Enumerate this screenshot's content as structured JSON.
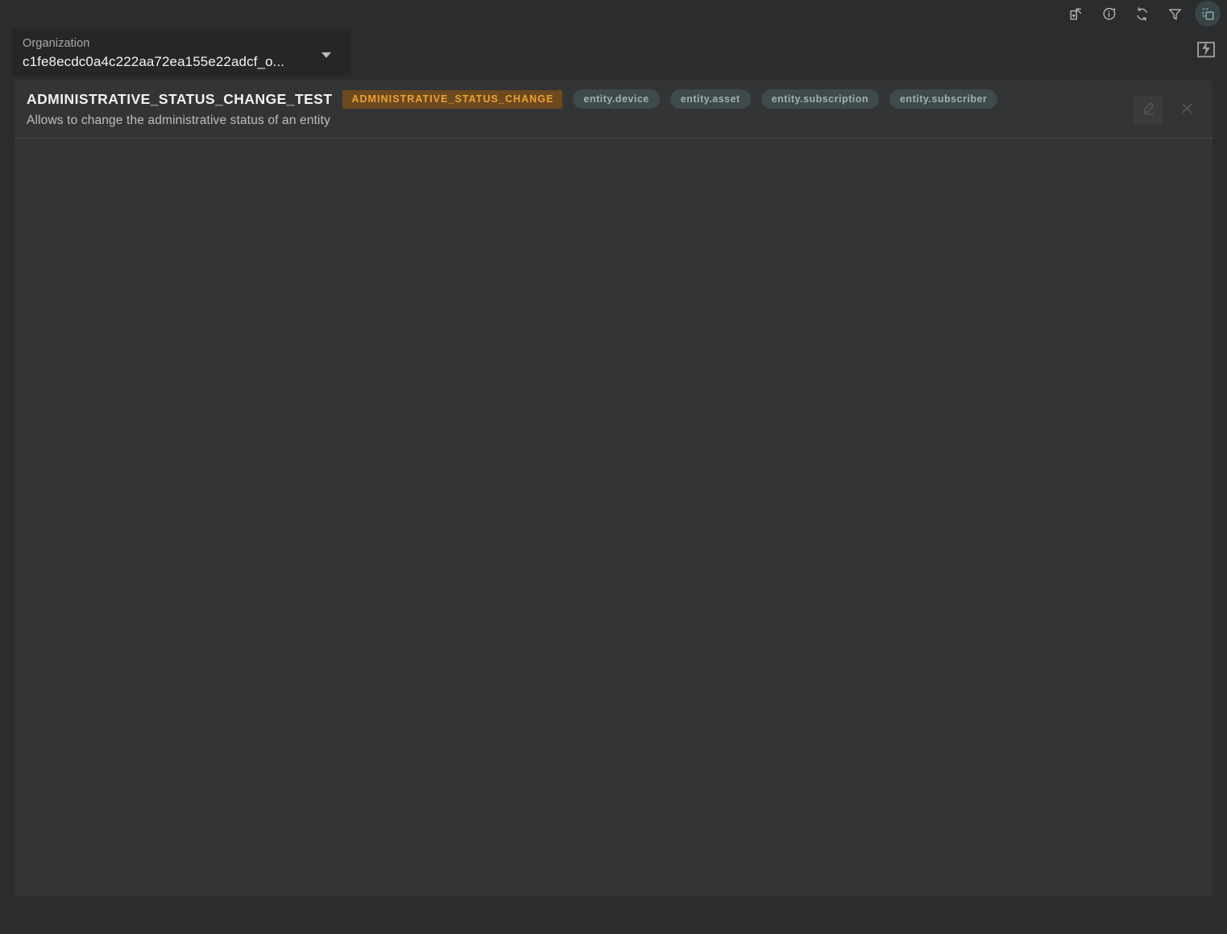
{
  "toolbar": {
    "icons": [
      {
        "name": "export-add-icon",
        "label": "Export"
      },
      {
        "name": "info-icon",
        "label": "Info"
      },
      {
        "name": "refresh-icon",
        "label": "Refresh"
      },
      {
        "name": "filter-icon",
        "label": "Filter"
      },
      {
        "name": "select-objects-icon",
        "label": "Select objects",
        "active": true
      }
    ],
    "flash_icon": "flash-action-icon",
    "accent_color": "#7fb3ae"
  },
  "organization": {
    "label": "Organization",
    "value": "c1fe8ecdc0a4c222aa72ea155e22adcf_o...",
    "caret": "chevron-down-icon"
  },
  "panel": {
    "title": "ADMINISTRATIVE_STATUS_CHANGE_TEST",
    "subtitle": "Allows to change the administrative status of an entity",
    "type_badge": {
      "label": "ADMINISTRATIVE_STATUS_CHANGE",
      "background": "#6b4a1f",
      "color": "#f0a030"
    },
    "entity_badges": [
      {
        "label": "entity.device"
      },
      {
        "label": "entity.asset"
      },
      {
        "label": "entity.subscription"
      },
      {
        "label": "entity.subscriber"
      }
    ],
    "badge_background": "#3f4a4a",
    "badge_color": "#9fb2b2",
    "actions": [
      {
        "name": "edit-button",
        "icon": "pencil-icon",
        "label": "Edit"
      },
      {
        "name": "close-button",
        "icon": "close-icon",
        "label": "Close"
      }
    ]
  },
  "colors": {
    "page_background": "#2b2c2e",
    "panel_background": "#333436",
    "field_background": "#252628",
    "divider": "#474849"
  }
}
